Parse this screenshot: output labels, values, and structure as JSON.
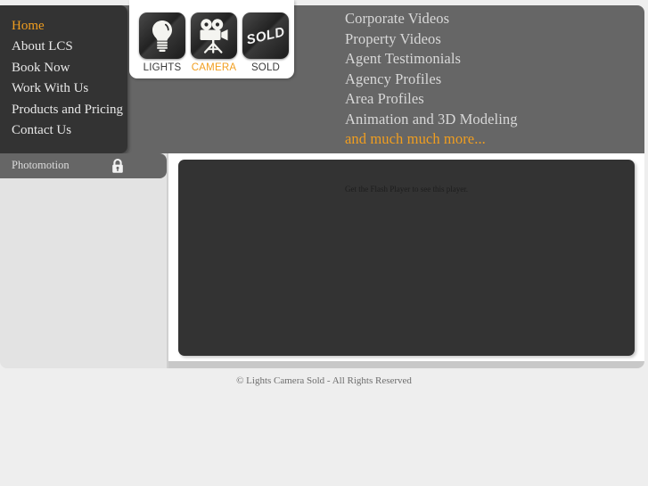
{
  "site": {
    "name": "Lights Camera Sold",
    "accent_color": "#f19e1f",
    "dark_color": "#333333",
    "grey_color": "#666666"
  },
  "nav": {
    "items": [
      {
        "label": "Home",
        "active": true
      },
      {
        "label": "About LCS",
        "active": false
      },
      {
        "label": "Book Now",
        "active": false
      },
      {
        "label": "Work With Us",
        "active": false
      },
      {
        "label": "Products and Pricing",
        "active": false
      },
      {
        "label": "Contact Us",
        "active": false
      }
    ]
  },
  "photomotion": {
    "label": "Photomotion",
    "icon": "lock-icon"
  },
  "tabs": [
    {
      "label": "LIGHTS",
      "icon": "lightbulb-icon",
      "active": false
    },
    {
      "label": "CAMERA",
      "icon": "movie-camera-icon",
      "active": true
    },
    {
      "label": "SOLD",
      "icon": "sold-stamp-icon",
      "active": false
    }
  ],
  "services": {
    "items": [
      {
        "label": "Corporate Videos",
        "accent": false
      },
      {
        "label": "Property Videos",
        "accent": false
      },
      {
        "label": "Agent Testimonials",
        "accent": false
      },
      {
        "label": "Agency Profiles",
        "accent": false
      },
      {
        "label": "Area Profiles",
        "accent": false
      },
      {
        "label": "Animation and 3D Modeling",
        "accent": false
      },
      {
        "label": "and much much more...",
        "accent": true
      }
    ]
  },
  "player": {
    "message": "Get the Flash Player to see this player."
  },
  "footer": {
    "copyright": "© Lights Camera Sold - All Rights Reserved"
  }
}
